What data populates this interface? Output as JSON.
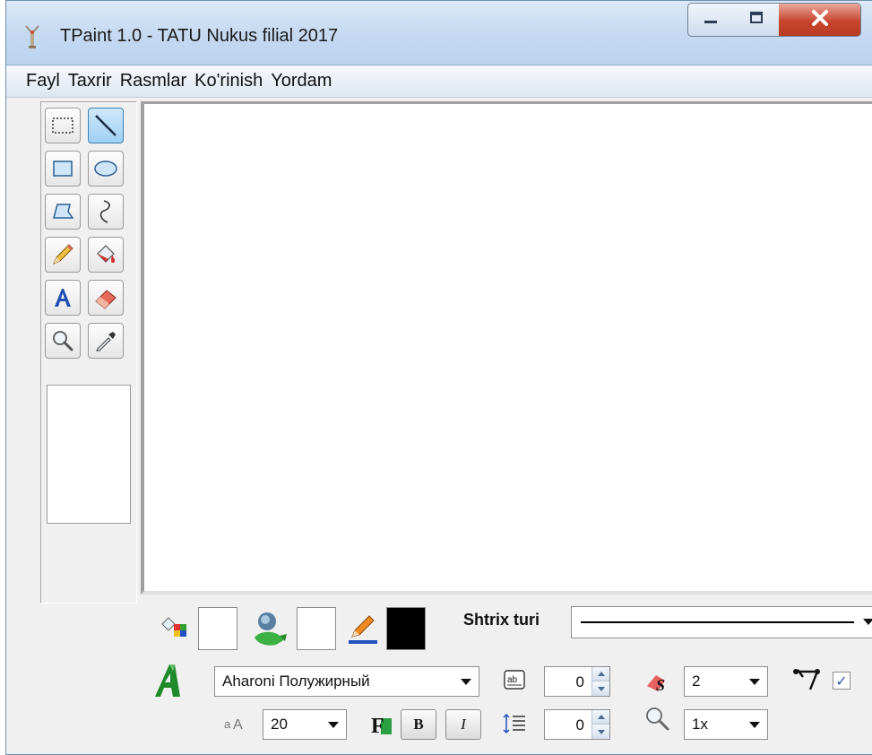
{
  "window": {
    "title": "TPaint 1.0 - TATU Nukus filial 2017",
    "controls": {
      "minimize": "minimize",
      "maximize": "maximize",
      "close": "close"
    }
  },
  "menu": {
    "items": [
      "Fayl",
      "Taxrir",
      "Rasmlar",
      "Ko'rinish",
      "Yordam"
    ]
  },
  "tools": [
    {
      "name": "rect-select",
      "icon": "dashed-rectangle-icon"
    },
    {
      "name": "line",
      "icon": "line-icon",
      "active": true
    },
    {
      "name": "rectangle",
      "icon": "rectangle-icon"
    },
    {
      "name": "ellipse",
      "icon": "ellipse-icon"
    },
    {
      "name": "polygon",
      "icon": "polygon-icon"
    },
    {
      "name": "curve",
      "icon": "curve-icon"
    },
    {
      "name": "pencil",
      "icon": "pencil-icon"
    },
    {
      "name": "fill",
      "icon": "paint-bucket-icon"
    },
    {
      "name": "text",
      "icon": "text-a-icon"
    },
    {
      "name": "eraser",
      "icon": "eraser-icon"
    },
    {
      "name": "zoom",
      "icon": "magnifier-icon"
    },
    {
      "name": "color-picker",
      "icon": "eyedropper-icon"
    }
  ],
  "colors": {
    "fill_color": "#ffffff",
    "gradient_color": "#ffffff",
    "stroke_color": "#000000",
    "accent": "#3c7fb1"
  },
  "stroke": {
    "label": "Shtrix turi"
  },
  "font": {
    "name": "Aharoni Полужирный",
    "size": "20",
    "bold_label": "B",
    "italic_label": "I"
  },
  "spacing": {
    "char_spacing": "0",
    "line_spacing": "0"
  },
  "brush": {
    "width": "2",
    "zoom": "1x",
    "shape_checked": true,
    "check_mark": "✓"
  }
}
